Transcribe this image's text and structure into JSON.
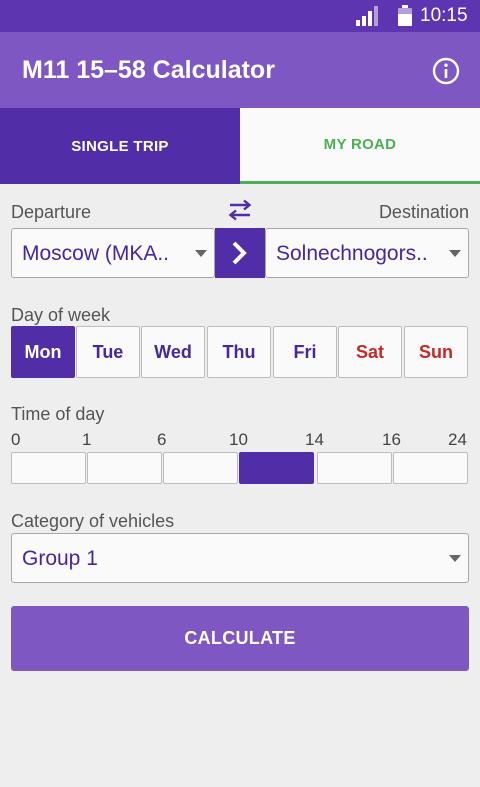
{
  "status_bar": {
    "time": "10:15"
  },
  "app_bar": {
    "title": "M11 15–58 Calculator"
  },
  "tabs": [
    {
      "label": "SINGLE TRIP",
      "active": true
    },
    {
      "label": "MY ROAD",
      "active": false
    }
  ],
  "route": {
    "departure_label": "Departure",
    "destination_label": "Destination",
    "departure_value": "Moscow (MKA..",
    "destination_value": "Solnechnogors.."
  },
  "day_of_week": {
    "label": "Day of week",
    "days": [
      "Mon",
      "Tue",
      "Wed",
      "Thu",
      "Fri",
      "Sat",
      "Sun"
    ],
    "selected": "Mon"
  },
  "time_of_day": {
    "label": "Time of day",
    "ticks": [
      "0",
      "1",
      "6",
      "10",
      "14",
      "16",
      "24"
    ],
    "selected_slot": 3
  },
  "vehicle": {
    "label": "Category of vehicles",
    "value": "Group 1"
  },
  "calculate_label": "CALCULATE",
  "colors": {
    "status_bar": "#5e35b1",
    "app_bar": "#7e57c2",
    "primary_dark": "#512da8",
    "accent_green": "#4caf50",
    "weekend_red": "#c62828"
  }
}
